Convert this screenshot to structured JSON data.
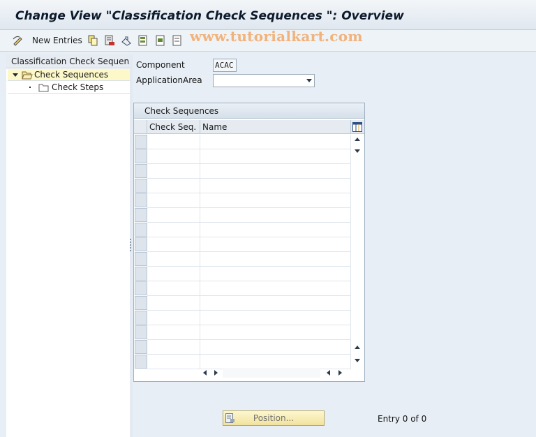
{
  "window": {
    "title": "Change View \"Classification Check Sequences \": Overview",
    "watermark": "www.tutorialkart.com"
  },
  "toolbar": {
    "new_entries_label": "New Entries",
    "icons": [
      "display-change-icon",
      "copy-icon",
      "delete-icon",
      "undo-icon",
      "select-all-icon",
      "select-block-icon",
      "deselect-all-icon"
    ]
  },
  "tree": {
    "header": "Classification Check Sequen...",
    "items": [
      {
        "label": "Check Sequences",
        "selected": true
      },
      {
        "label": "Check Steps",
        "selected": false
      }
    ]
  },
  "form": {
    "component_label": "Component",
    "component_value": "ACAC",
    "application_area_label": "ApplicationArea",
    "application_area_value": ""
  },
  "table": {
    "title": "Check Sequences",
    "columns": [
      "Check Seq.",
      "Name"
    ],
    "visible_row_count": 16,
    "rows": []
  },
  "footer": {
    "position_label": "Position...",
    "entry_text": "Entry 0 of 0"
  },
  "colors": {
    "background": "#e7eef5",
    "tree_selected": "#fcf8c9",
    "position_button": "#f1e39d",
    "watermark": "#f1b27b"
  }
}
